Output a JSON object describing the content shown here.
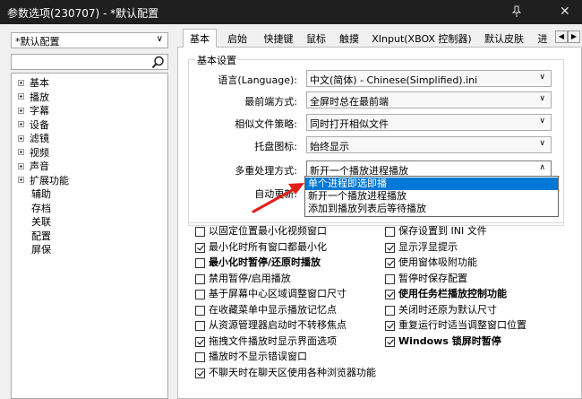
{
  "window": {
    "title": "参数选项(230707) - *默认配置",
    "close_glyph": "✕"
  },
  "profile_select": {
    "value": "*默认配置"
  },
  "tree": {
    "items": [
      {
        "label": "基本",
        "expandable": true
      },
      {
        "label": "播放",
        "expandable": true
      },
      {
        "label": "字幕",
        "expandable": true
      },
      {
        "label": "设备",
        "expandable": true
      },
      {
        "label": "滤镜",
        "expandable": true
      },
      {
        "label": "视频",
        "expandable": true
      },
      {
        "label": "声音",
        "expandable": true
      },
      {
        "label": "扩展功能",
        "expandable": true
      },
      {
        "label": "辅助",
        "expandable": false
      },
      {
        "label": "存档",
        "expandable": false
      },
      {
        "label": "关联",
        "expandable": false
      },
      {
        "label": "配置",
        "expandable": false
      },
      {
        "label": "屏保",
        "expandable": false
      }
    ]
  },
  "tabs": [
    "基本",
    "启始",
    "快捷键",
    "鼠标",
    "触摸",
    "XInput(XBOX 控制器)",
    "默认皮肤",
    "进"
  ],
  "active_tab": "基本",
  "basic": {
    "group_title": "基本设置",
    "fields": [
      {
        "label": "语言(Language):",
        "value": "中文(简体) - Chinese(Simplified).ini"
      },
      {
        "label": "最前端方式:",
        "value": "全屏时总在最前端"
      },
      {
        "label": "相似文件策略:",
        "value": "同时打开相似文件"
      },
      {
        "label": "托盘图标:",
        "value": "始终显示"
      },
      {
        "label": "多重处理方式:",
        "value": "新开一个播放进程播放"
      },
      {
        "label": "自动更新:",
        "value": ""
      }
    ],
    "dropdown_options": [
      {
        "label": "单个进程即选即播",
        "selected": true
      },
      {
        "label": "新开一个播放进程播放",
        "selected": false
      },
      {
        "label": "添加到播放列表后等待播放",
        "selected": false
      }
    ]
  },
  "checkboxes_left": [
    {
      "label": "以固定位置最小化视频窗口",
      "checked": false,
      "bold": false
    },
    {
      "label": "最小化时所有窗口都最小化",
      "checked": true,
      "bold": false
    },
    {
      "label": "最小化时暂停/还原时播放",
      "checked": false,
      "bold": true
    },
    {
      "label": "禁用暂停/启用播放",
      "checked": false,
      "bold": false
    },
    {
      "label": "基于屏幕中心区域调整窗口尺寸",
      "checked": false,
      "bold": false
    },
    {
      "label": "在收藏菜单中显示播放记忆点",
      "checked": false,
      "bold": false
    },
    {
      "label": "从资源管理器启动时不转移焦点",
      "checked": false,
      "bold": false
    },
    {
      "label": "拖拽文件播放时显示界面选项",
      "checked": true,
      "bold": false
    },
    {
      "label": "播放时不显示错误窗口",
      "checked": false,
      "bold": false
    },
    {
      "label": "不聊天时在聊天区使用各种浏览器功能",
      "checked": true,
      "bold": false
    }
  ],
  "checkboxes_right": [
    {
      "label": "保存设置到 INI 文件",
      "checked": false,
      "bold": false
    },
    {
      "label": "显示浮显提示",
      "checked": true,
      "bold": false
    },
    {
      "label": "使用窗体吸附功能",
      "checked": true,
      "bold": false
    },
    {
      "label": "暂停时保存配置",
      "checked": false,
      "bold": false
    },
    {
      "label": "使用任务栏播放控制功能",
      "checked": true,
      "bold": true
    },
    {
      "label": "关闭时还原为默认尺寸",
      "checked": false,
      "bold": false
    },
    {
      "label": "重复运行时适当调整窗口位置",
      "checked": true,
      "bold": false
    },
    {
      "label": "Windows 锁屏时暂停",
      "checked": true,
      "bold": true
    }
  ],
  "colors": {
    "titlebar": "#1f1f1f",
    "selection": "#0078d7",
    "annotation_arrow": "#e0201b"
  }
}
